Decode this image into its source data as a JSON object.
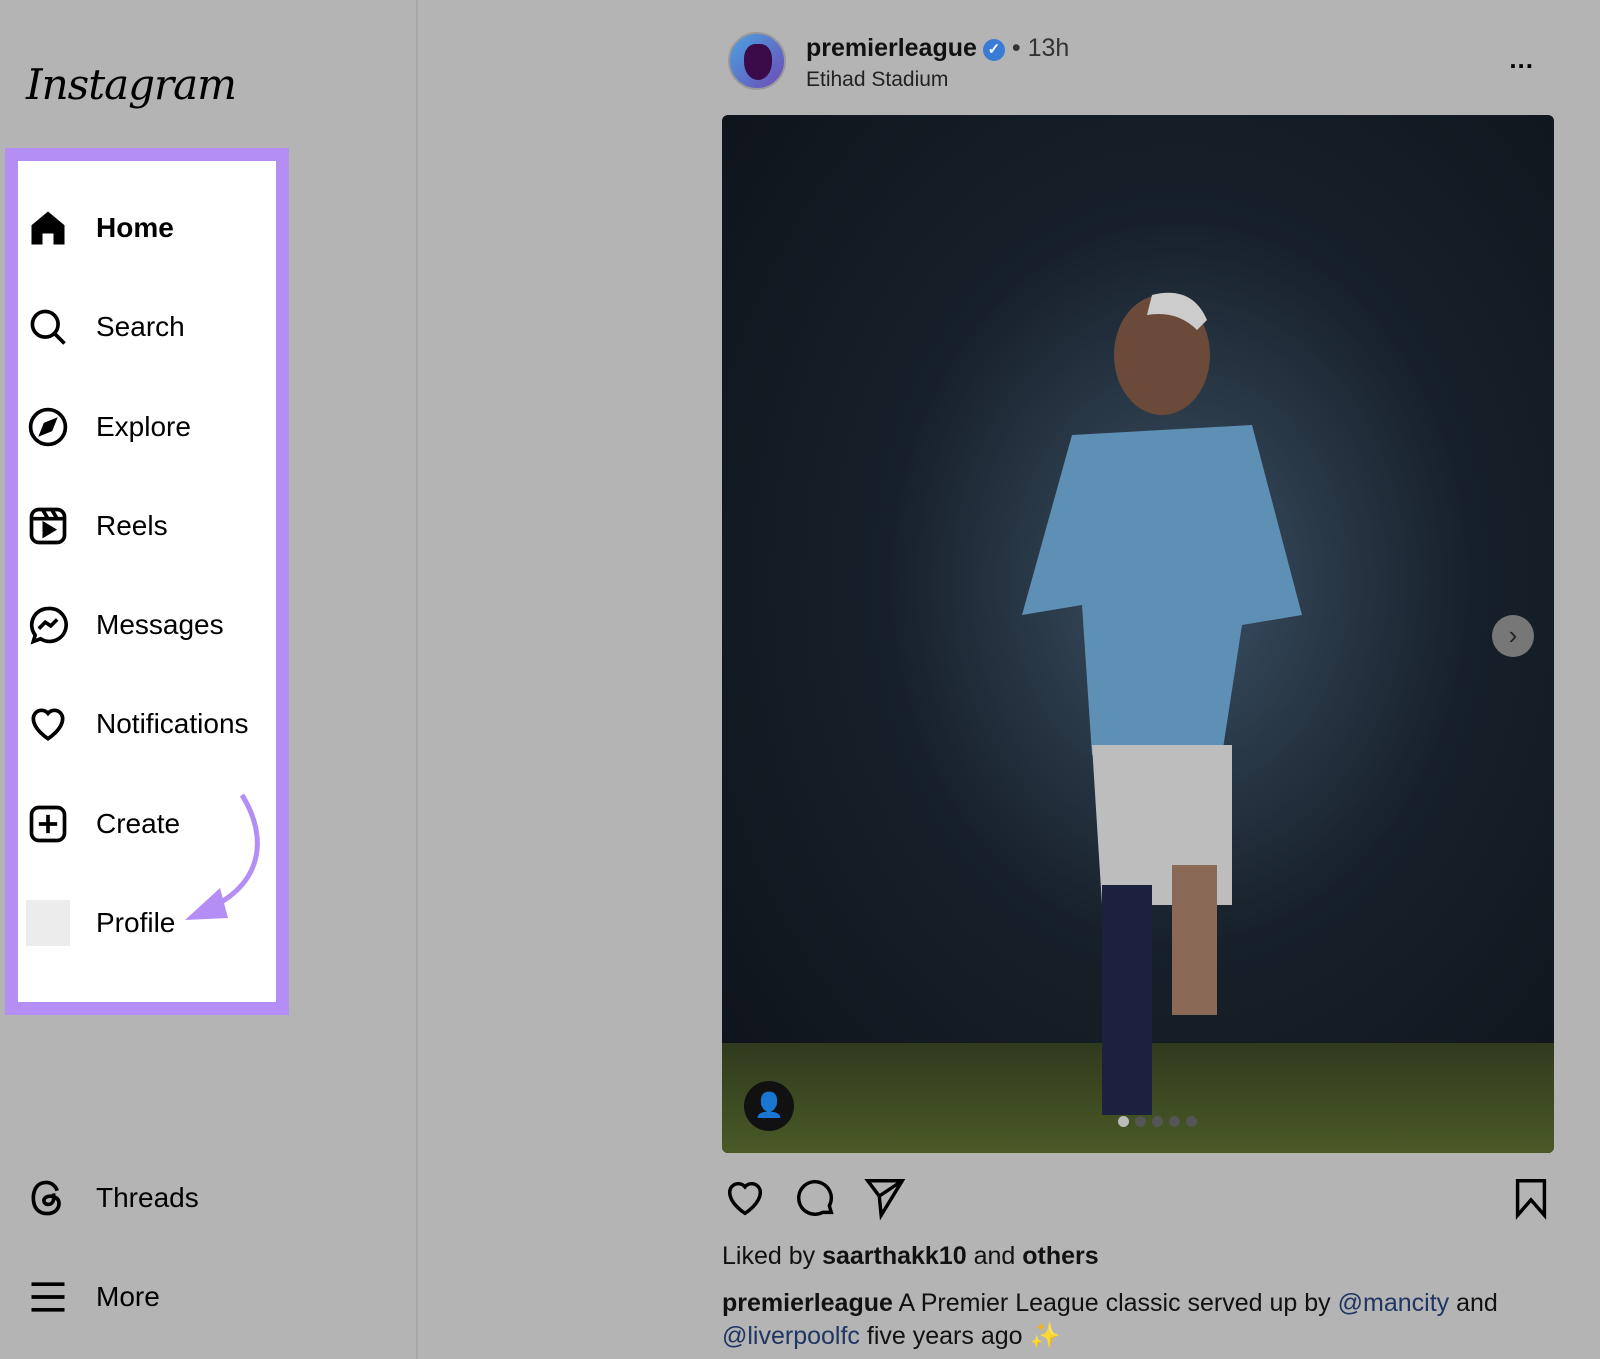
{
  "sidebar": {
    "logo": "Instagram",
    "items": [
      {
        "label": "Home",
        "icon": "home-icon"
      },
      {
        "label": "Search",
        "icon": "search-icon"
      },
      {
        "label": "Explore",
        "icon": "compass-icon"
      },
      {
        "label": "Reels",
        "icon": "reels-icon"
      },
      {
        "label": "Messages",
        "icon": "messenger-icon"
      },
      {
        "label": "Notifications",
        "icon": "heart-icon"
      },
      {
        "label": "Create",
        "icon": "plus-square-icon"
      },
      {
        "label": "Profile",
        "icon": "avatar"
      }
    ],
    "bottom": [
      {
        "label": "Threads",
        "icon": "threads-icon"
      },
      {
        "label": "More",
        "icon": "menu-icon"
      }
    ],
    "highlight_color": "#b48ef5"
  },
  "post": {
    "username": "premierleague",
    "verified": "✓",
    "separator": "•",
    "time": "13h",
    "location": "Etihad Stadium",
    "more": "...",
    "carousel": {
      "current": 1,
      "total": 5
    },
    "liked_prefix": "Liked by",
    "liked_user": "saarthakk10",
    "liked_and": "and",
    "liked_others": "others",
    "caption_user": "premierleague",
    "caption_1": "A Premier League classic served up by",
    "mention_1": "@mancity",
    "caption_2": "and",
    "mention_2": "@liverpoolfc",
    "caption_3": "five years ago",
    "emoji": "✨"
  }
}
